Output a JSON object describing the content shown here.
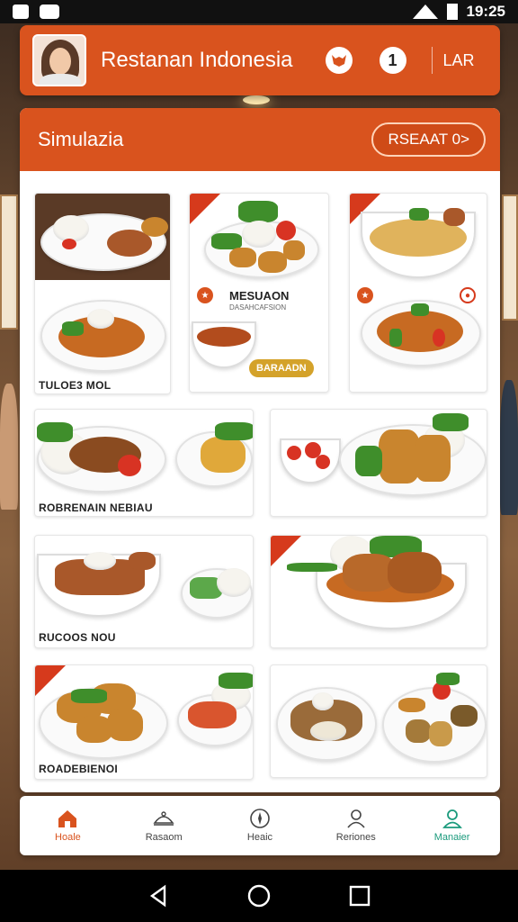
{
  "status_bar": {
    "time": "19:25"
  },
  "header": {
    "title": "Restanan Indonesia",
    "badge_count": "1",
    "language": "LAR"
  },
  "panel": {
    "title": "Simulazia",
    "action_label": "RSEAAT 0>"
  },
  "cards": [
    {
      "label": "TULOE3 MOL"
    },
    {
      "title": "MESUAON",
      "subtitle": "DASAHCAFSION",
      "chip": "BARAADN"
    },
    {
      "label": ""
    },
    {
      "label": "ROBRENAIN NEBIAU"
    },
    {
      "label": ""
    },
    {
      "label": "RUCOOS NOU"
    },
    {
      "label": ""
    },
    {
      "label": "ROADEBIENOI"
    },
    {
      "label": ""
    }
  ],
  "bottom_nav": [
    {
      "label": "Hoale",
      "icon": "home-icon",
      "active": true
    },
    {
      "label": "Rasaom",
      "icon": "dish-icon"
    },
    {
      "label": "Heaic",
      "icon": "compass-icon"
    },
    {
      "label": "Reriones",
      "icon": "user-icon"
    },
    {
      "label": "Manaier",
      "icon": "manager-icon"
    }
  ],
  "colors": {
    "accent": "#d9531e",
    "chip": "#d4a22a",
    "manager_green": "#1a9a7c"
  }
}
